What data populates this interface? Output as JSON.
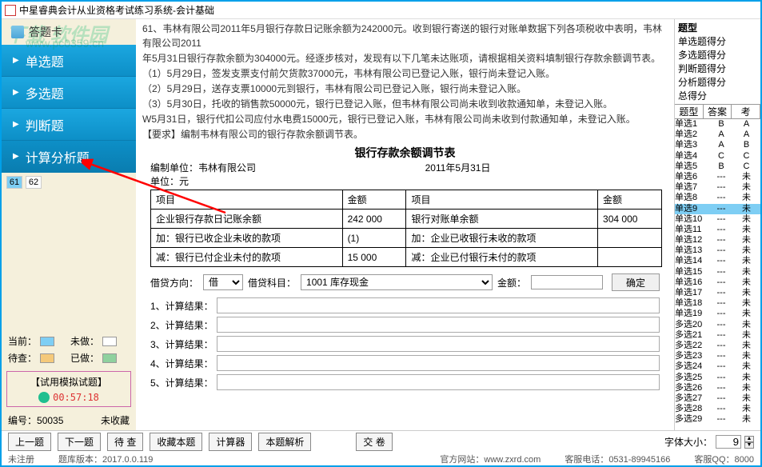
{
  "title": "中星睿典会计从业资格考试练习系统-会计基础",
  "watermark": {
    "line1": "下载 软件园",
    "line2": "www.pc0359.cn"
  },
  "sidebar": {
    "header": "答题卡",
    "nav": [
      {
        "label": "单选题"
      },
      {
        "label": "多选题"
      },
      {
        "label": "判断题"
      },
      {
        "label": "计算分析题"
      }
    ],
    "qnums": [
      "61",
      "62"
    ],
    "legend": {
      "current": "当前：",
      "undone": "未做：",
      "pending": "待查：",
      "done": "已做："
    },
    "trial": "【试用模拟试题】",
    "timer": "00:57:18",
    "code_label": "编号：",
    "code": "50035",
    "fav": "未收藏"
  },
  "question": {
    "lines": [
      "61、韦林有限公司2011年5月银行存款日记账余额为242000元。收到银行寄送的银行对账单数据下列各项税收中表明，韦林有限公司2011",
      "年5月31日银行存款余额为304000元。经逐步核对，发现有以下几笔未达账项，请根据相关资料填制银行存款余额调节表。",
      "（1）5月29日，签发支票支付前欠货款37000元，韦林有限公司已登记入账，银行尚未登记入账。",
      "（2）5月29日，送存支票10000元到银行，韦林有限公司已登记入账，银行尚未登记入账。",
      "（3）5月30日，托收的销售款50000元，银行已登记入账，但韦林有限公司尚未收到收款通知单，未登记入账。",
      "W5月31日，银行代扣公司应付水电费15000元，银行已登记入账，韦林有限公司尚未收到付款通知单，未登记入账。",
      "【要求】编制韦林有限公司的银行存款余额调节表。"
    ],
    "table_title": "银行存款余额调节表",
    "compiler_label": "编制单位：",
    "compiler": "韦林有限公司",
    "date": "2011年5月31日",
    "unit": "单位：元",
    "table": {
      "h1": "项目",
      "h2": "金额",
      "h3": "项目",
      "h4": "金额",
      "r1c1": "企业银行存款日记账余额",
      "r1c2": "242 000",
      "r1c3": "银行对账单余额",
      "r1c4": "304 000",
      "r2c1": "加：银行已收企业未收的款项",
      "r2c2": "(1)",
      "r2c3": "加：企业已收银行未收的款项",
      "r2c4": "",
      "r3c1": "减：银行已付企业未付的款项",
      "r3c2": "15 000",
      "r3c3": "减：企业已付银行未付的款项",
      "r3c4": ""
    },
    "form": {
      "debit_label": "借贷方向：",
      "debit_value": "借",
      "subject_label": "借贷科目：",
      "subject_value": "1001 库存现金",
      "amount_label": "金额：",
      "amount_value": "",
      "confirm": "确定"
    },
    "results": [
      "1、计算结果：",
      "2、计算结果：",
      "3、计算结果：",
      "4、计算结果：",
      "5、计算结果："
    ]
  },
  "right": {
    "head_title": "题型",
    "rows": [
      "单选题得分",
      "多选题得分",
      "判断题得分",
      "分析题得分",
      "总得分"
    ],
    "qa_head": {
      "c1": "题型",
      "c2": "答案",
      "c3": "考"
    },
    "items": [
      {
        "n": "单选1",
        "a": "B",
        "k": "A"
      },
      {
        "n": "单选2",
        "a": "A",
        "k": "A"
      },
      {
        "n": "单选3",
        "a": "A",
        "k": "B"
      },
      {
        "n": "单选4",
        "a": "C",
        "k": "C"
      },
      {
        "n": "单选5",
        "a": "B",
        "k": "C"
      },
      {
        "n": "单选6",
        "a": "---",
        "k": "未"
      },
      {
        "n": "单选7",
        "a": "---",
        "k": "未"
      },
      {
        "n": "单选8",
        "a": "---",
        "k": "未"
      },
      {
        "n": "单选9",
        "a": "---",
        "k": "未"
      },
      {
        "n": "单选10",
        "a": "---",
        "k": "未"
      },
      {
        "n": "单选11",
        "a": "---",
        "k": "未"
      },
      {
        "n": "单选12",
        "a": "---",
        "k": "未"
      },
      {
        "n": "单选13",
        "a": "---",
        "k": "未"
      },
      {
        "n": "单选14",
        "a": "---",
        "k": "未"
      },
      {
        "n": "单选15",
        "a": "---",
        "k": "未"
      },
      {
        "n": "单选16",
        "a": "---",
        "k": "未"
      },
      {
        "n": "单选17",
        "a": "---",
        "k": "未"
      },
      {
        "n": "单选18",
        "a": "---",
        "k": "未"
      },
      {
        "n": "单选19",
        "a": "---",
        "k": "未"
      },
      {
        "n": "多选20",
        "a": "---",
        "k": "未"
      },
      {
        "n": "多选21",
        "a": "---",
        "k": "未"
      },
      {
        "n": "多选22",
        "a": "---",
        "k": "未"
      },
      {
        "n": "多选23",
        "a": "---",
        "k": "未"
      },
      {
        "n": "多选24",
        "a": "---",
        "k": "未"
      },
      {
        "n": "多选25",
        "a": "---",
        "k": "未"
      },
      {
        "n": "多选26",
        "a": "---",
        "k": "未"
      },
      {
        "n": "多选27",
        "a": "---",
        "k": "未"
      },
      {
        "n": "多选28",
        "a": "---",
        "k": "未"
      },
      {
        "n": "多选29",
        "a": "---",
        "k": "未"
      }
    ]
  },
  "bottom": {
    "prev": "上一题",
    "next": "下一题",
    "pending": "待  查",
    "fav": "收藏本题",
    "calc": "计算器",
    "parse": "本题解析",
    "submit": "交  卷",
    "fontsize_label": "字体大小：",
    "fontsize": "9"
  },
  "status": {
    "reg": "未注册",
    "verlabel": "题库版本：",
    "ver": "2017.0.0.119",
    "sitelabel": "官方网站：",
    "site": "www.zxrd.com",
    "tellabel": "客服电话：",
    "tel": "0531-89945166",
    "qqlabel": "客服QQ：",
    "qq": "8000"
  }
}
